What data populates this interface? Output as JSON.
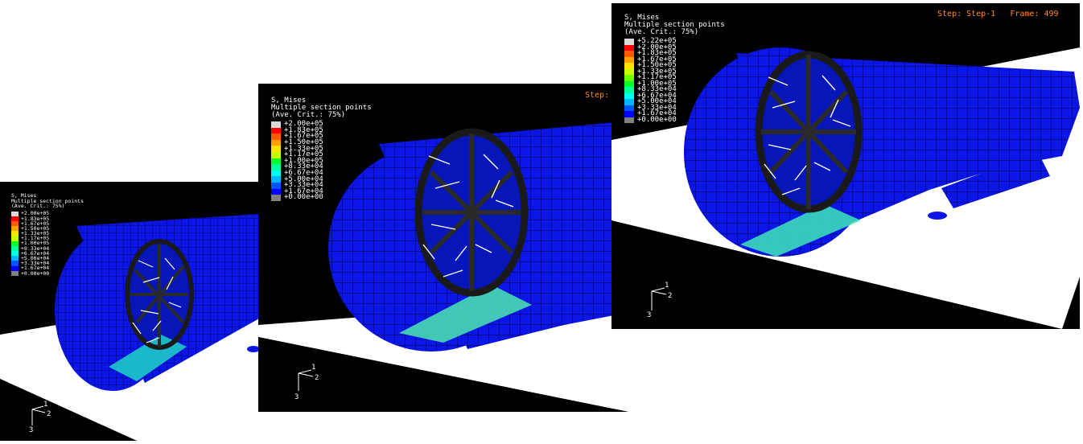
{
  "legend_colors": [
    "#d9d9d9",
    "#ff0000",
    "#ff5a00",
    "#ff9f00",
    "#ffe100",
    "#c8ff00",
    "#6cff00",
    "#00ff2a",
    "#00ff9a",
    "#00fff0",
    "#00b8ff",
    "#0055ff",
    "#0000ff",
    "#808080"
  ],
  "mesh_color": "#0b16e6",
  "viewports": [
    {
      "legend": {
        "title": "S, Mises",
        "subtitle": "Multiple section points",
        "criterion": "(Ave. Crit.: 75%)",
        "values": [
          "+2.00e+05",
          "+1.83e+05",
          "+1.67e+05",
          "+1.50e+05",
          "+1.33e+05",
          "+1.17e+05",
          "+1.00e+05",
          "+8.33e+04",
          "+6.67e+04",
          "+5.00e+04",
          "+3.33e+04",
          "+1.67e+04",
          "+0.00e+00"
        ]
      },
      "triad": {
        "axis_1": "1",
        "axis_2": "2",
        "axis_3": "3"
      }
    },
    {
      "legend": {
        "title": "S, Mises",
        "subtitle": "Multiple section points",
        "criterion": "(Ave. Crit.: 75%)",
        "values": [
          "+2.00e+05",
          "+1.83e+05",
          "+1.67e+05",
          "+1.50e+05",
          "+1.33e+05",
          "+1.17e+05",
          "+1.00e+05",
          "+8.33e+04",
          "+6.67e+04",
          "+5.00e+04",
          "+3.33e+04",
          "+1.67e+04",
          "+0.00e+00"
        ]
      },
      "step_text": "Step:",
      "triad": {
        "axis_1": "1",
        "axis_2": "2",
        "axis_3": "3"
      }
    },
    {
      "legend": {
        "title": "S, Mises",
        "subtitle": "Multiple section points",
        "criterion": "(Ave. Crit.: 75%)",
        "values": [
          "+5.22e+05",
          "+2.00e+05",
          "+1.83e+05",
          "+1.67e+05",
          "+1.50e+05",
          "+1.33e+05",
          "+1.17e+05",
          "+1.00e+05",
          "+8.33e+04",
          "+6.67e+04",
          "+5.00e+04",
          "+3.33e+04",
          "+1.67e+04",
          "+0.00e+00"
        ]
      },
      "step_text": "Step: Step-1",
      "frame_text": "Frame: 499",
      "triad": {
        "axis_1": "1",
        "axis_2": "2",
        "axis_3": "3"
      }
    }
  ]
}
